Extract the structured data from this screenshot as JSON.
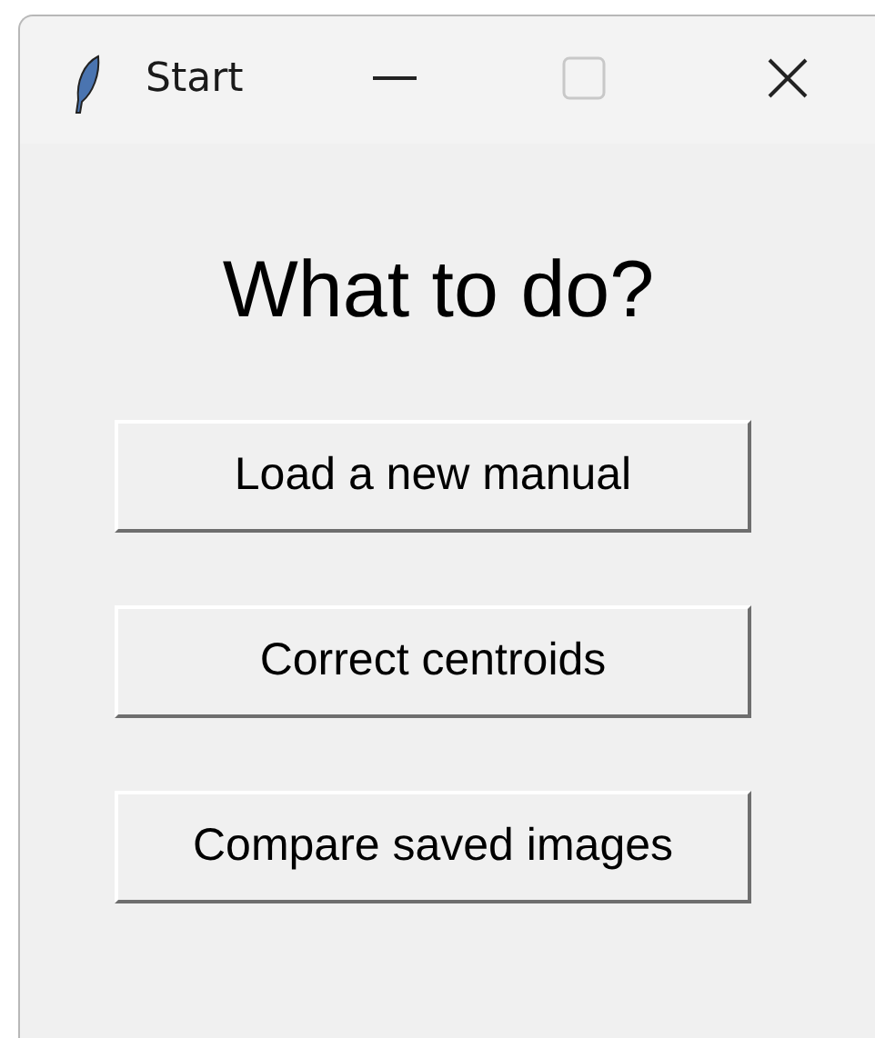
{
  "window": {
    "title": "Start"
  },
  "heading": "What to do?",
  "buttons": [
    "Load a new manual",
    "Correct centroids",
    "Compare saved images"
  ]
}
